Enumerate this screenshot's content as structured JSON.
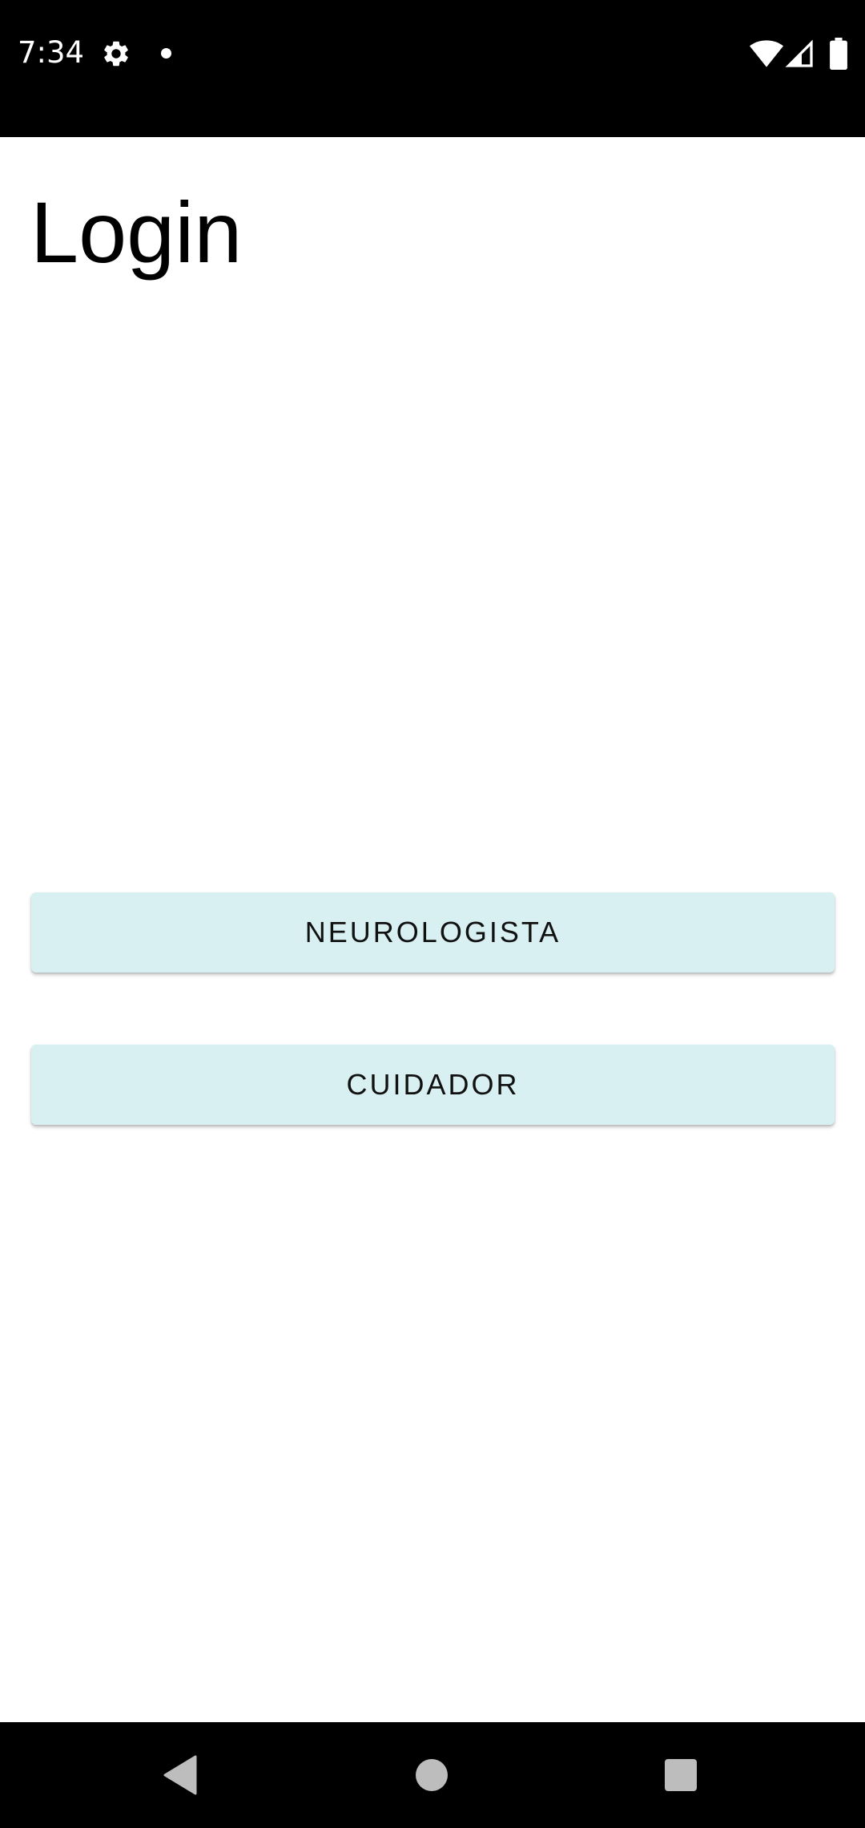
{
  "status_bar": {
    "time": "7:34",
    "icons": [
      "gear-icon",
      "notification-dot-icon",
      "wifi-icon",
      "cell-signal-icon",
      "battery-icon"
    ]
  },
  "screen": {
    "title": "Login"
  },
  "buttons": {
    "neurologista": "NEUROLOGISTA",
    "cuidador": "CUIDADOR"
  },
  "navigation_bar": {
    "icons": [
      "back-icon",
      "home-icon",
      "recents-icon"
    ]
  },
  "colors": {
    "button_background": "#d8f0f1",
    "status_bar": "#000000",
    "nav_bar": "#000000",
    "nav_icon": "#bdbdbd"
  }
}
